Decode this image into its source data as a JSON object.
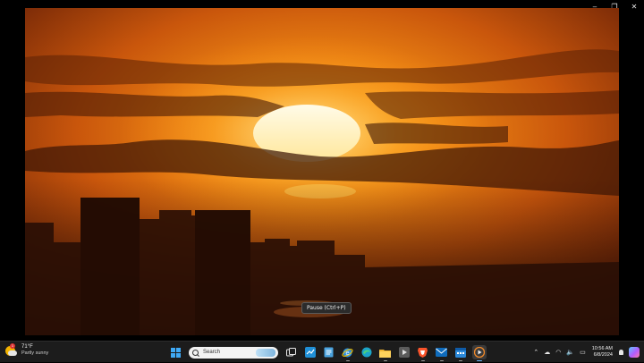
{
  "window": {
    "controls": {
      "minimize": "–",
      "restore": "❐",
      "close": "✕"
    },
    "tooltip": "Pause (Ctrl+P)"
  },
  "taskbar": {
    "weather": {
      "temperature": "71°F",
      "condition": "Partly sunny",
      "badge": "1",
      "icon": "partly-sunny-icon"
    },
    "search": {
      "placeholder": "Search"
    },
    "apps": [
      {
        "name": "start-icon"
      },
      {
        "name": "task-view-icon"
      },
      {
        "name": "widgets-icon"
      },
      {
        "name": "notepad-icon"
      },
      {
        "name": "ie-icon"
      },
      {
        "name": "edge-icon"
      },
      {
        "name": "file-explorer-icon"
      },
      {
        "name": "media-app-icon"
      },
      {
        "name": "brave-icon"
      },
      {
        "name": "mail-icon"
      },
      {
        "name": "calendar-icon"
      },
      {
        "name": "media-player-icon",
        "active": true
      }
    ],
    "tray": {
      "chevron": "⌃",
      "onedrive": "☁",
      "wifi": "◠",
      "volume": "🔈",
      "battery": "▭",
      "time": "10:56 AM",
      "date": "6/8/2024"
    }
  },
  "colors": {
    "accent": "#3fa9f5",
    "taskbar": "#1c1c1c",
    "sky": "#c9560c",
    "sun": "#fff6dc"
  }
}
